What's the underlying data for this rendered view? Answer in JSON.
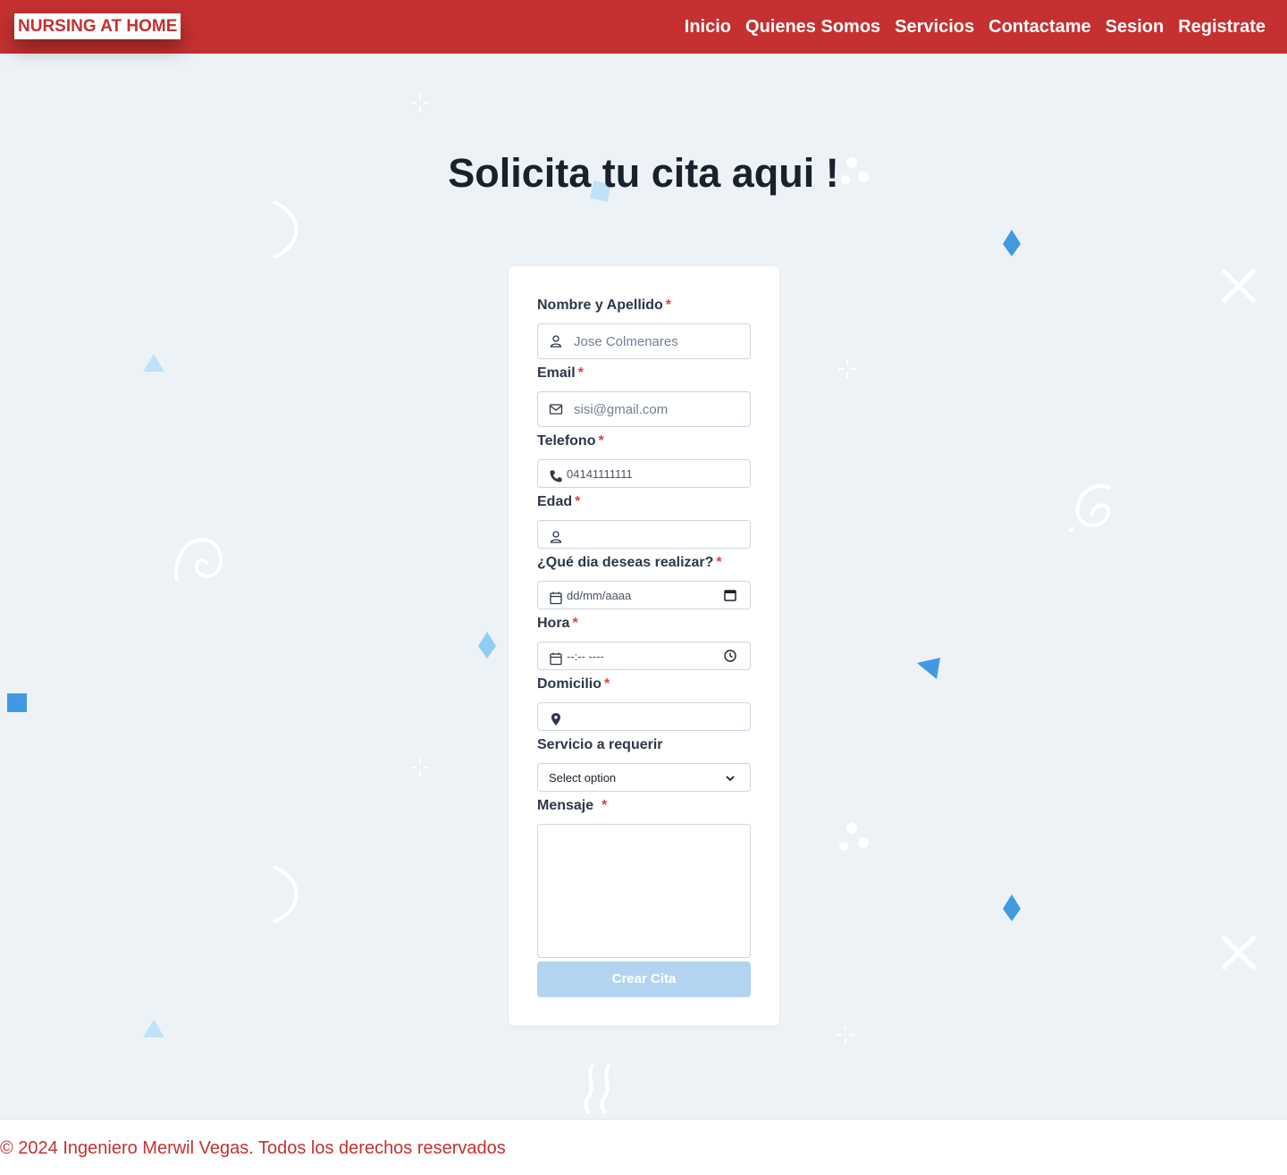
{
  "brand": "NURSING AT HOME",
  "nav": [
    "Inicio",
    "Quienes Somos",
    "Servicios",
    "Contactame",
    "Sesion",
    "Registrate"
  ],
  "title": "Solicita tu cita aqui !",
  "form": {
    "name_label": "Nombre y Apellido",
    "name_placeholder": "Jose Colmenares",
    "email_label": "Email",
    "email_placeholder": "sisi@gmail.com",
    "phone_label": "Telefono",
    "phone_placeholder": "04141111111",
    "age_label": "Edad",
    "date_label": "¿Qué dia deseas realizar?",
    "date_placeholder": "dd/mm/aaaa",
    "time_label": "Hora",
    "time_placeholder": "--:-- ----",
    "address_label": "Domicilio",
    "service_label": "Servicio a requerir",
    "service_selected": "Select option",
    "message_label": "Mensaje",
    "required_mark": "*",
    "submit": "Crear Cita"
  },
  "footer": "© 2024 Ingeniero Merwil Vegas. Todos los derechos reservados",
  "colors": {
    "primary": "#c53030",
    "background": "#edf2f7",
    "button_disabled": "#b3d4f0",
    "required": "#e53e3e"
  }
}
